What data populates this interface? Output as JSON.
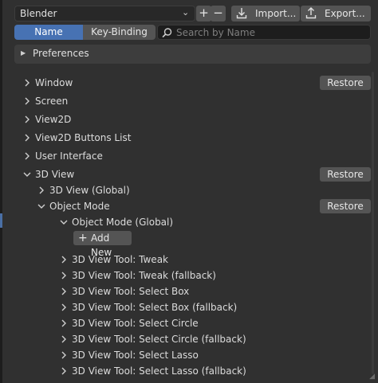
{
  "header": {
    "preset_value": "Blender",
    "add_icon": "plus-icon",
    "remove_icon": "minus-icon",
    "import_label": "Import...",
    "export_label": "Export..."
  },
  "filter": {
    "name_tab": "Name",
    "keybinding_tab": "Key-Binding",
    "search_placeholder": "Search by Name"
  },
  "preferences_panel": {
    "label": "Preferences"
  },
  "tree": {
    "window": "Window",
    "screen": "Screen",
    "view2d": "View2D",
    "view2d_buttons": "View2D Buttons List",
    "user_interface": "User Interface",
    "view3d": "3D View",
    "view3d_global": "3D View (Global)",
    "object_mode": "Object Mode",
    "object_mode_global": "Object Mode (Global)",
    "add_new": "Add New",
    "tools": [
      "3D View Tool: Tweak",
      "3D View Tool: Tweak (fallback)",
      "3D View Tool: Select Box",
      "3D View Tool: Select Box (fallback)",
      "3D View Tool: Select Circle",
      "3D View Tool: Select Circle (fallback)",
      "3D View Tool: Select Lasso",
      "3D View Tool: Select Lasso (fallback)"
    ]
  },
  "restore_label": "Restore",
  "colors": {
    "background": "#303030",
    "accent": "#4772b3",
    "button": "#545454",
    "field": "#1d1d1d"
  }
}
